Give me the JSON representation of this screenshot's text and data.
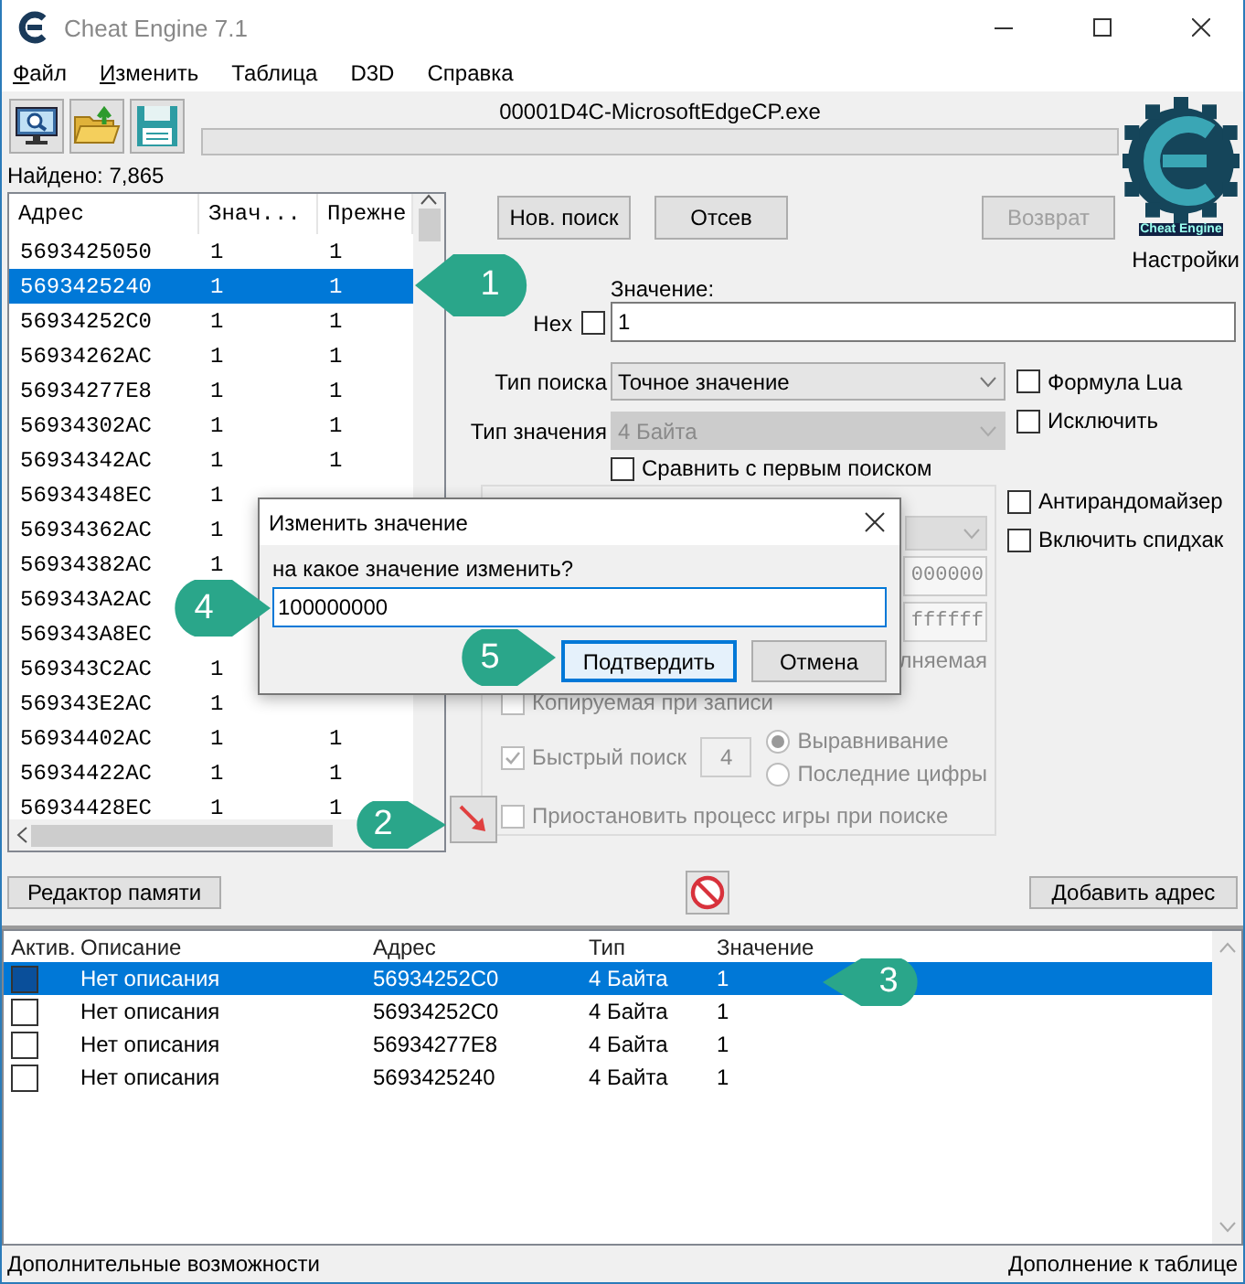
{
  "window": {
    "title": "Cheat Engine 7.1"
  },
  "menu": [
    {
      "label": "Файл",
      "accel": true
    },
    {
      "label": "Изменить",
      "accel": true
    },
    {
      "label": "Таблица",
      "accel": false
    },
    {
      "label": "D3D",
      "accel": false
    },
    {
      "label": "Справка",
      "accel": false
    }
  ],
  "process": "00001D4C-MicrosoftEdgeCP.exe",
  "logo_text": "Cheat Engine",
  "settings_label": "Настройки",
  "found": "Найдено: 7,865",
  "found_list": {
    "columns": [
      "Адрес",
      "Знач...",
      "Прежне"
    ],
    "rows": [
      {
        "address": "5693425050",
        "value": "1",
        "previous": "1",
        "selected": false
      },
      {
        "address": "5693425240",
        "value": "1",
        "previous": "1",
        "selected": true
      },
      {
        "address": "56934252C0",
        "value": "1",
        "previous": "1",
        "selected": false
      },
      {
        "address": "56934262AC",
        "value": "1",
        "previous": "1",
        "selected": false
      },
      {
        "address": "56934277E8",
        "value": "1",
        "previous": "1",
        "selected": false
      },
      {
        "address": "56934302AC",
        "value": "1",
        "previous": "1",
        "selected": false
      },
      {
        "address": "56934342AC",
        "value": "1",
        "previous": "1",
        "selected": false
      },
      {
        "address": "56934348EC",
        "value": "1",
        "selected": false
      },
      {
        "address": "56934362AC",
        "value": "1",
        "selected": false
      },
      {
        "address": "56934382AC",
        "value": "1",
        "selected": false
      },
      {
        "address": "569343A2AC",
        "selected": false
      },
      {
        "address": "569343A8EC",
        "selected": false
      },
      {
        "address": "569343C2AC",
        "value": "1",
        "selected": false
      },
      {
        "address": "569343E2AC",
        "value": "1",
        "selected": false
      },
      {
        "address": "56934402AC",
        "value": "1",
        "previous": "1",
        "selected": false
      },
      {
        "address": "56934422AC",
        "value": "1",
        "previous": "1",
        "selected": false
      },
      {
        "address": "56934428EC",
        "value": "1",
        "previous": "1",
        "selected": false
      }
    ]
  },
  "scan_buttons": [
    {
      "label": "Нов. поиск",
      "disabled": false
    },
    {
      "label": "Отсев",
      "disabled": false
    },
    {
      "label": "Возврат",
      "disabled": true
    }
  ],
  "value": {
    "label": "Значение:",
    "hex_label": "Hex",
    "hex_checked": false,
    "value": "1"
  },
  "scan_type": {
    "label": "Тип поиска",
    "value": "Точное значение",
    "disabled": false
  },
  "value_type": {
    "label": "Тип значения",
    "value": "4 Байта",
    "disabled": true
  },
  "compare_first": {
    "label": "Сравнить с первым поиском",
    "checked": false
  },
  "side_options": [
    {
      "label": "Формула Lua",
      "checked": false
    },
    {
      "label": "Исключить",
      "checked": false
    },
    {
      "label": "Антирандомайзер",
      "checked": false
    },
    {
      "label": "Включить спидхак",
      "checked": false
    }
  ],
  "memory_options": {
    "start_fragment": "000000",
    "stop_fragment": "ffffff",
    "executable_fragment": "лняемая",
    "copy_on_write": {
      "label": "Копируемая при записи",
      "checked": false,
      "disabled": true
    },
    "fast_scan": {
      "label": "Быстрый поиск",
      "checked": true,
      "disabled": true,
      "value": "4"
    },
    "alignment": [
      {
        "label": "Выравнивание",
        "selected": true
      },
      {
        "label": "Последние цифры",
        "selected": false
      }
    ],
    "pause": {
      "label": "Приостановить процесс игры при поиске",
      "checked": false,
      "disabled": true
    }
  },
  "memory_view_button": "Редактор памяти",
  "add_address_button": "Добавить адрес",
  "address_table": {
    "columns": [
      "Актив.",
      "Описание",
      "Адрес",
      "Тип",
      "Значение"
    ],
    "rows": [
      {
        "active": false,
        "description": "Нет описания",
        "address": "56934252C0",
        "type": "4 Байта",
        "value": "1",
        "selected": true
      },
      {
        "active": false,
        "description": "Нет описания",
        "address": "56934252C0",
        "type": "4 Байта",
        "value": "1",
        "selected": false
      },
      {
        "active": false,
        "description": "Нет описания",
        "address": "56934277E8",
        "type": "4 Байта",
        "value": "1",
        "selected": false
      },
      {
        "active": false,
        "description": "Нет описания",
        "address": "5693425240",
        "type": "4 Байта",
        "value": "1",
        "selected": false
      }
    ]
  },
  "status_bar": {
    "left": "Дополнительные возможности",
    "right": "Дополнение к таблице"
  },
  "dialog": {
    "title": "Изменить значение",
    "prompt": "на какое значение изменить?",
    "value": "100000000",
    "buttons": [
      {
        "label": "Подтвердить",
        "default": true
      },
      {
        "label": "Отмена",
        "default": false
      }
    ]
  },
  "callouts": [
    {
      "label": "1",
      "kind": "left"
    },
    {
      "label": "2",
      "kind": "right"
    },
    {
      "label": "3",
      "kind": "left"
    },
    {
      "label": "4",
      "kind": "right"
    },
    {
      "label": "5",
      "kind": "right"
    }
  ]
}
